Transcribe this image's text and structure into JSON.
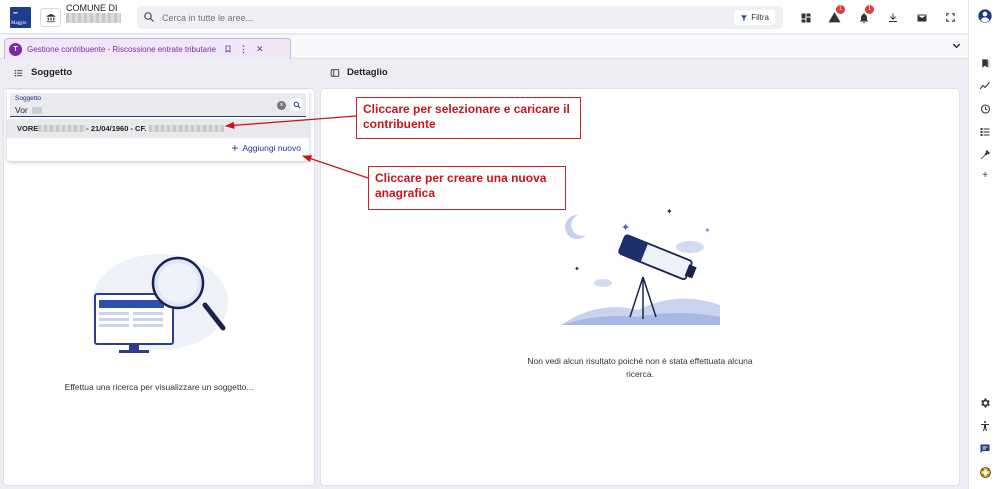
{
  "header": {
    "logo_text": "Maggio",
    "comune_label": "COMUNE DI",
    "search_placeholder": "Cerca in tutte le aree...",
    "filter_label": "Filtra",
    "alerts_badge": "1",
    "notifications_badge": "1"
  },
  "tab": {
    "icon_text": "T",
    "label": "Gestione contribuente - Riscossione entrate tributarie"
  },
  "left_panel": {
    "title": "Soggetto",
    "field_label": "Soggetto",
    "field_value": "Vor",
    "result_text": "VORE",
    "result_date": " - 21/04/1960 - CF.",
    "add_label": "Aggiungi nuovo",
    "empty_text": "Effettua una ricerca per visualizzare un soggetto..."
  },
  "right_panel": {
    "title": "Dettaglio",
    "empty_text": "Non vedi alcun risultato poiché non è stata effettuata alcuna ricerca."
  },
  "callouts": {
    "select": "Cliccare per selezionare e caricare il contribuente",
    "create": "Cliccare per creare una nuova anagrafica"
  },
  "colors": {
    "accent": "#1c3a8a",
    "tab_purple": "#7b2ca0",
    "callout_red": "#c8141a",
    "badge_red": "#e53935"
  }
}
